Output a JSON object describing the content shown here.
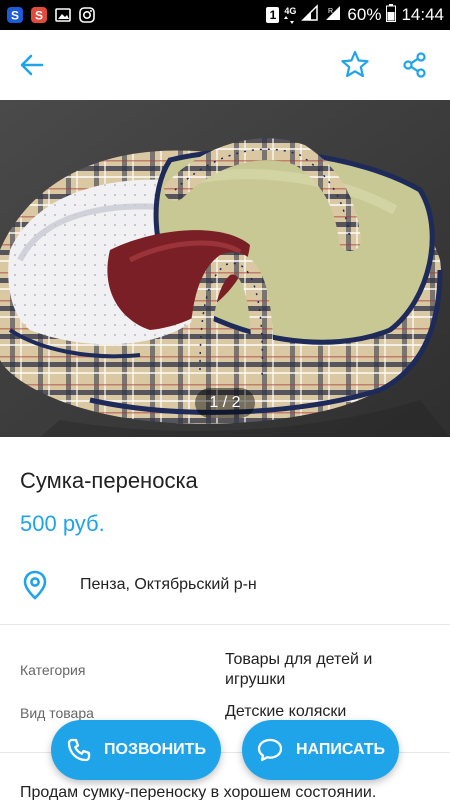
{
  "status_bar": {
    "battery": "60%",
    "time": "14:44",
    "sim_badge": "1",
    "network": "4G"
  },
  "app_bar": {
    "icons": [
      "arrow-back-icon",
      "star-outline-icon",
      "share-icon"
    ]
  },
  "gallery": {
    "counter": "1 / 2"
  },
  "listing": {
    "title": "Сумка-переноска",
    "price": "500 руб.",
    "location": "Пенза, Октябрьский р-н"
  },
  "params": [
    {
      "label": "Категория",
      "value": "Товары для детей и игрушки"
    },
    {
      "label": "Вид товара",
      "value": "Детские коляски"
    }
  ],
  "description": "Продам сумку-переноску в хорошем состоянии.",
  "actions": {
    "call_label": "ПОЗВОНИТЬ",
    "write_label": "НАПИСАТЬ"
  },
  "colors": {
    "accent": "#1fa4ea"
  }
}
